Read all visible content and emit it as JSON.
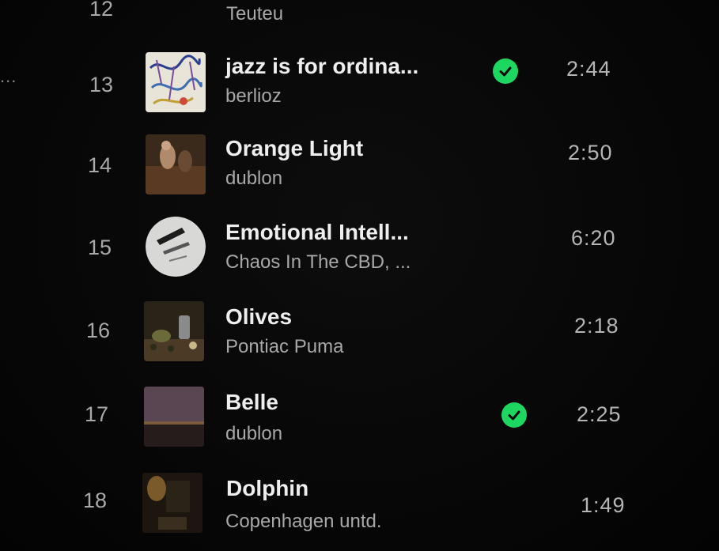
{
  "left_ellipsis": "...",
  "tracks": [
    {
      "number": "12",
      "title": "",
      "artist": "Teuteu",
      "duration": "",
      "liked": false
    },
    {
      "number": "13",
      "title": "jazz is for ordina...",
      "artist": "berlioz",
      "duration": "2:44",
      "liked": true
    },
    {
      "number": "14",
      "title": "Orange Light",
      "artist": "dublon",
      "duration": "2:50",
      "liked": false
    },
    {
      "number": "15",
      "title": "Emotional Intell...",
      "artist": "Chaos In The CBD, ...",
      "duration": "6:20",
      "liked": false
    },
    {
      "number": "16",
      "title": "Olives",
      "artist": "Pontiac Puma",
      "duration": "2:18",
      "liked": false
    },
    {
      "number": "17",
      "title": "Belle",
      "artist": "dublon",
      "duration": "2:25",
      "liked": true
    },
    {
      "number": "18",
      "title": "Dolphin",
      "artist": "Copenhagen untd.",
      "duration": "1:49",
      "liked": false
    }
  ],
  "colors": {
    "background": "#050505",
    "liked_check": "#1ed760",
    "title_text": "#eeeeee",
    "secondary_text": "#a8a8a8"
  }
}
